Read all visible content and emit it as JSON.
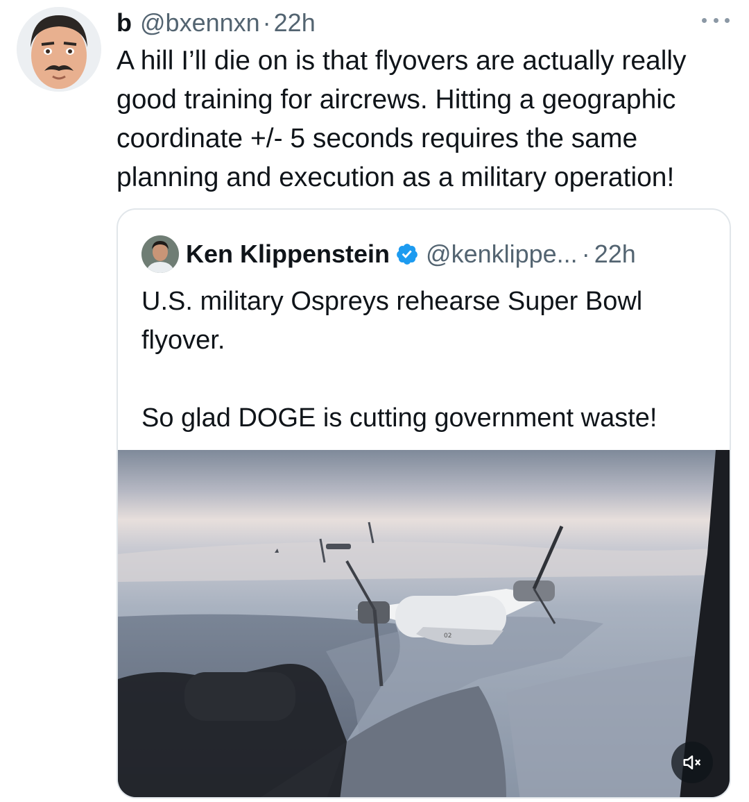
{
  "tweet": {
    "author_name": "b",
    "handle": "@bxennxn",
    "separator": "·",
    "time": "22h",
    "text": "A hill I’ll die on is that flyovers are actually really good training for aircrews. Hitting a geographic coordinate +/- 5 seconds requires the same planning and execution as a military operation!"
  },
  "quoted": {
    "author_name": "Ken Klippenstein",
    "handle": "@kenklippe...",
    "separator": "·",
    "time": "22h",
    "text_line1": "U.S. military Ospreys rehearse Super Bowl flyover.",
    "text_line2": "So glad DOGE is cutting government waste!",
    "media_label": "02"
  },
  "icons": {
    "more": "more-horizontal-icon",
    "verified": "verified-badge-icon",
    "mute": "speaker-muted-icon"
  },
  "colors": {
    "text": "#0f1419",
    "secondary": "#536471",
    "verified_blue": "#1d9bf0",
    "border": "#e1e6ea"
  }
}
